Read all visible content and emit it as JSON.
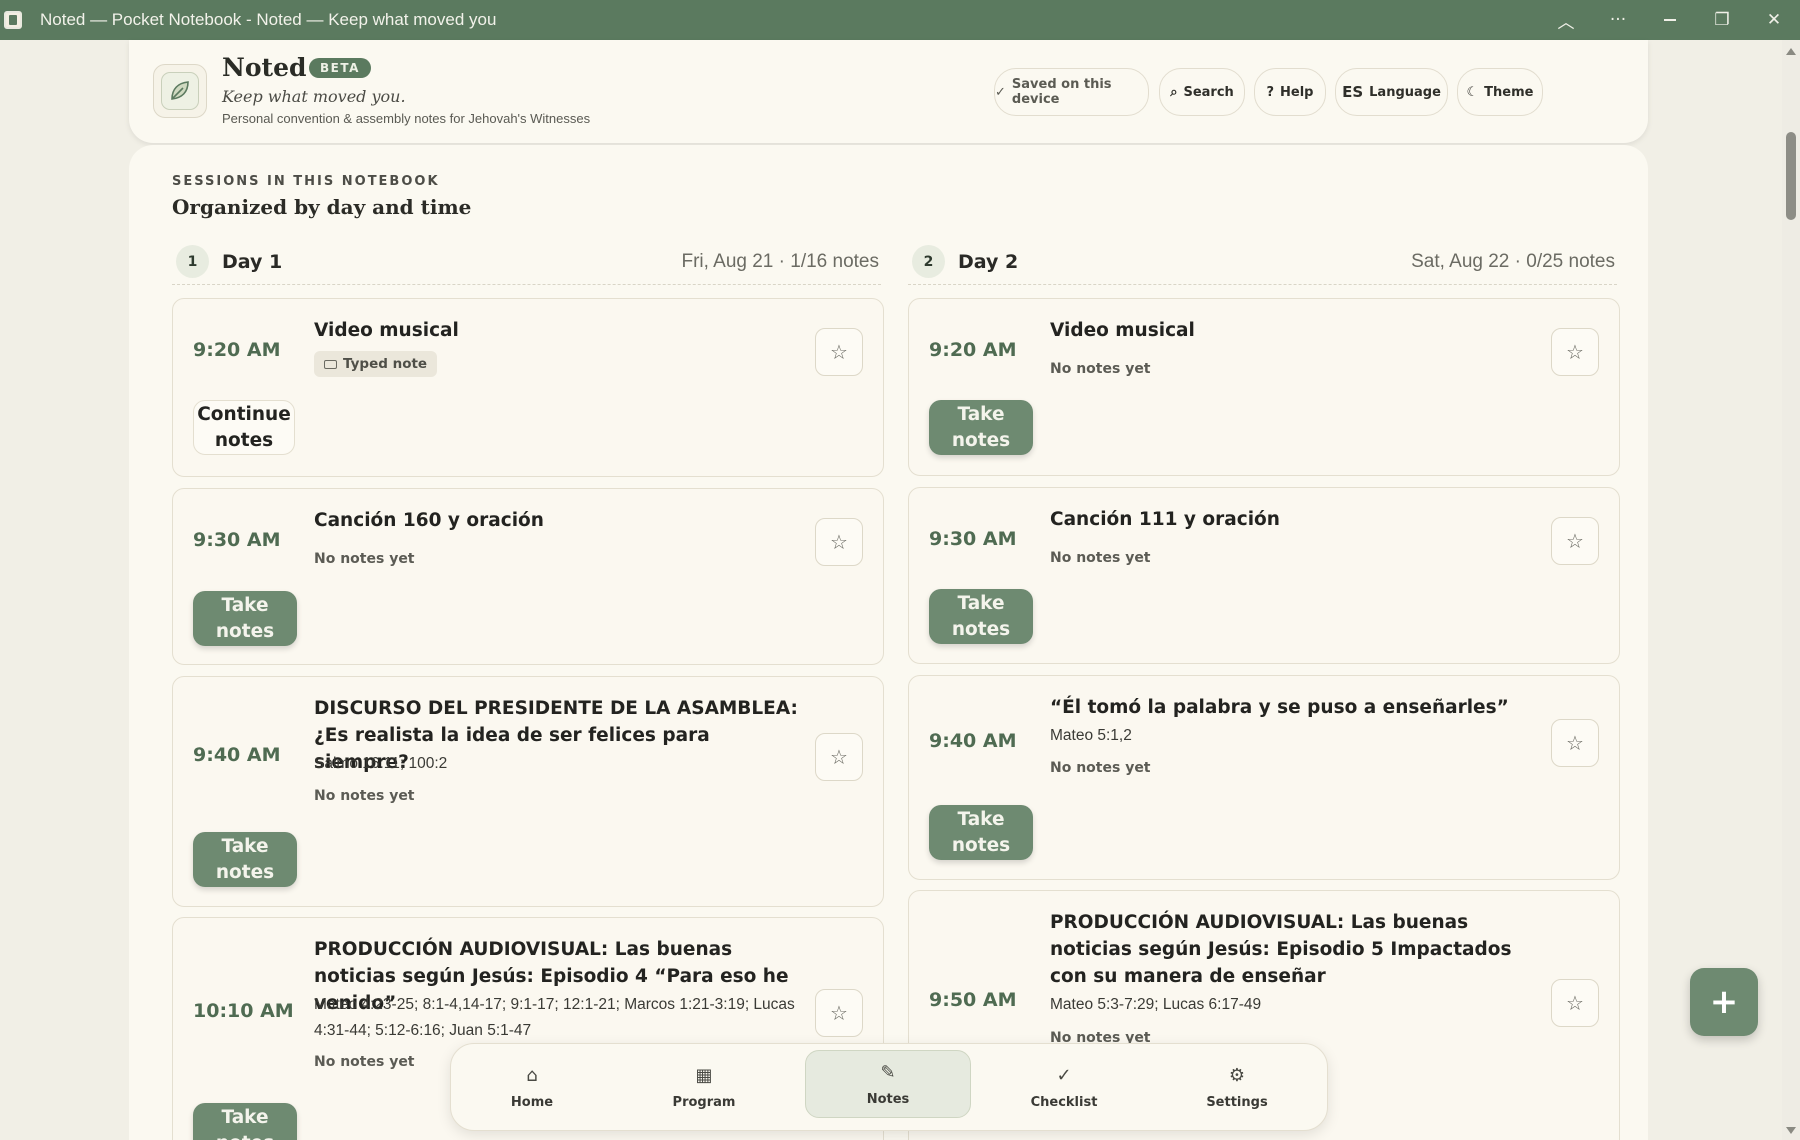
{
  "window": {
    "title": "Noted — Pocket Notebook - Noted — Keep what moved you"
  },
  "header": {
    "app_name": "Noted",
    "badge": "BETA",
    "tagline": "Keep what moved you.",
    "subtitle": "Personal convention & assembly notes for Jehovah's Witnesses",
    "buttons": {
      "saved": "Saved on this device",
      "search": "Search",
      "help": "Help",
      "language_code": "ES",
      "language": "Language",
      "theme": "Theme"
    }
  },
  "sessions": {
    "eyebrow": "SESSIONS IN THIS NOTEBOOK",
    "title": "Organized by day and time",
    "days": [
      {
        "num": "1",
        "label": "Day 1",
        "meta": "Fri, Aug 21 · 1/16 notes",
        "items": [
          {
            "time": "9:20 AM",
            "title": "Video musical",
            "ref": "",
            "status": "Typed note",
            "button": "Continue notes"
          },
          {
            "time": "9:30 AM",
            "title": "Canción 160 y oración",
            "ref": "",
            "status": "No notes yet",
            "button": "Take notes"
          },
          {
            "time": "9:40 AM",
            "title": "DISCURSO DEL PRESIDENTE DE LA ASAMBLEA: ¿Es realista la idea de ser felices para siempre?",
            "ref": "Salmo 16:11; 100:2",
            "status": "No notes yet",
            "button": "Take notes"
          },
          {
            "time": "10:10 AM",
            "title": "PRODUCCIÓN AUDIOVISUAL: Las buenas noticias según Jesús: Episodio 4 “Para eso he venido”",
            "ref": "Mateo 4:23-25; 8:1-4,14-17; 9:1-17; 12:1-21; Marcos 1:21-3:19; Lucas 4:31-44; 5:12-6:16; Juan 5:1-47",
            "status": "No notes yet",
            "button": "Take notes"
          }
        ]
      },
      {
        "num": "2",
        "label": "Day 2",
        "meta": "Sat, Aug 22 · 0/25 notes",
        "items": [
          {
            "time": "9:20 AM",
            "title": "Video musical",
            "ref": "",
            "status": "No notes yet",
            "button": "Take notes"
          },
          {
            "time": "9:30 AM",
            "title": "Canción 111 y oración",
            "ref": "",
            "status": "No notes yet",
            "button": "Take notes"
          },
          {
            "time": "9:40 AM",
            "title": "“Él tomó la palabra y se puso a enseñarles”",
            "ref": "Mateo 5:1,2",
            "status": "No notes yet",
            "button": "Take notes"
          },
          {
            "time": "9:50 AM",
            "title": "PRODUCCIÓN AUDIOVISUAL: Las buenas noticias según Jesús: Episodio 5 Impactados con su manera de enseñar",
            "ref": "Mateo 5:3-7:29; Lucas 6:17-49",
            "status": "No notes yet",
            "button": ""
          }
        ]
      }
    ]
  },
  "nav": {
    "items": [
      {
        "label": "Home",
        "icon": "home-icon"
      },
      {
        "label": "Program",
        "icon": "grid-icon"
      },
      {
        "label": "Notes",
        "icon": "pencil-icon"
      },
      {
        "label": "Checklist",
        "icon": "check-icon"
      },
      {
        "label": "Settings",
        "icon": "gear-icon"
      }
    ],
    "active": "Notes"
  },
  "fab": {
    "label": "+"
  },
  "colors": {
    "titlebar": "#5b7a5f",
    "accent": "#6e8a71",
    "time_text": "#4f6b52",
    "background": "#f1efe6",
    "card": "#fbf8f0"
  }
}
